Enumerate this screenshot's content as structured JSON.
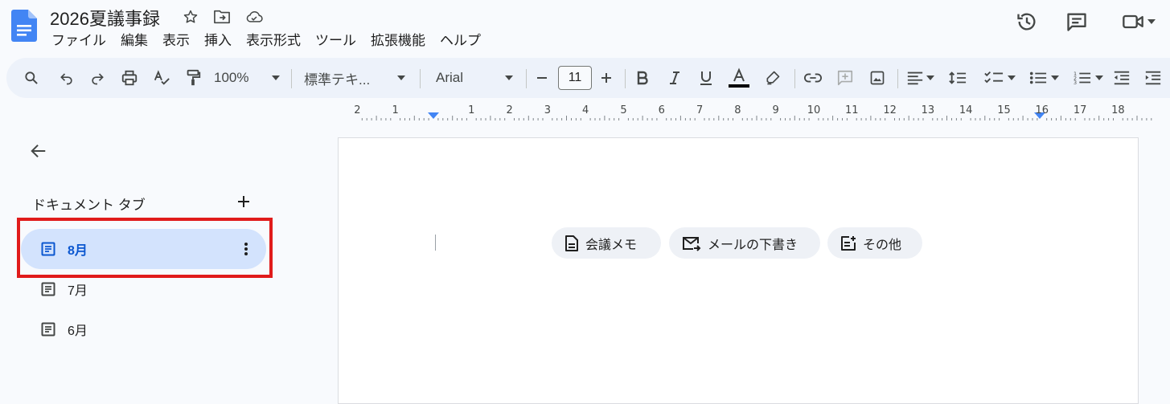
{
  "document": {
    "title": "2026夏議事録"
  },
  "menu": [
    "ファイル",
    "編集",
    "表示",
    "挿入",
    "表示形式",
    "ツール",
    "拡張機能",
    "ヘルプ"
  ],
  "toolbar": {
    "zoom": "100%",
    "style": "標準テキ...",
    "font": "Arial",
    "font_size": "11"
  },
  "ruler": {
    "labels": [
      "2",
      "1",
      "1",
      "2",
      "3",
      "4",
      "5",
      "6",
      "7",
      "8",
      "9",
      "10",
      "11",
      "12",
      "13",
      "14",
      "15",
      "16",
      "17",
      "18"
    ]
  },
  "sidebar": {
    "heading": "ドキュメント タブ",
    "tabs": [
      {
        "label": "8月",
        "selected": true
      },
      {
        "label": "7月",
        "selected": false
      },
      {
        "label": "6月",
        "selected": false
      }
    ]
  },
  "chips": [
    {
      "label": "会議メモ",
      "icon": "document-icon"
    },
    {
      "label": "メールの下書き",
      "icon": "mail-arrow-icon"
    },
    {
      "label": "その他",
      "icon": "note-add-icon"
    }
  ],
  "colors": {
    "accent": "#0b57d0",
    "selected_tab_bg": "#d3e3fd",
    "highlight_border": "#e01b1b",
    "toolbar_bg": "#edf2fa"
  }
}
